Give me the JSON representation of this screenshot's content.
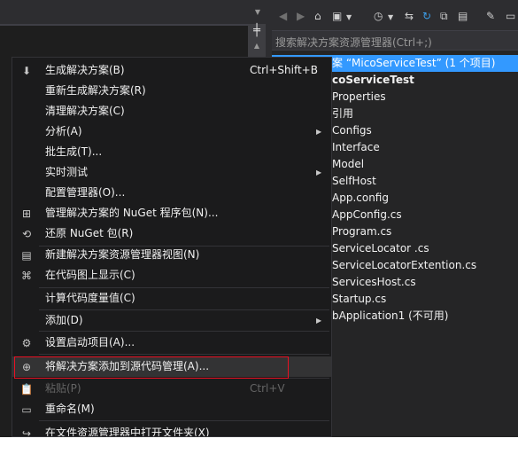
{
  "solution_explorer": {
    "search_placeholder": "搜索解决方案资源管理器(Ctrl+;)",
    "toolbar_icons": [
      "back-icon",
      "forward-icon",
      "home-icon",
      "switch-views-icon",
      "dropdown-arrow-icon",
      "history-icon",
      "dropdown-arrow-icon",
      "sync-icon",
      "refresh-icon",
      "collapse-all-icon",
      "show-all-files-icon",
      "properties-icon",
      "preview-icon"
    ],
    "tree": [
      {
        "label": "案 “MicoServiceTest” (1 个项目)",
        "selected": true
      },
      {
        "label": "coServiceTest",
        "bold": true
      },
      {
        "label": "Properties"
      },
      {
        "label": "引用"
      },
      {
        "label": "Configs"
      },
      {
        "label": "Interface"
      },
      {
        "label": "Model"
      },
      {
        "label": "SelfHost"
      },
      {
        "label": "App.config"
      },
      {
        "label": "AppConfig.cs"
      },
      {
        "label": "Program.cs"
      },
      {
        "label": "ServiceLocator .cs"
      },
      {
        "label": "ServiceLocatorExtention.cs"
      },
      {
        "label": "ServicesHost.cs"
      },
      {
        "label": "Startup.cs"
      },
      {
        "label": "bApplication1 (不可用)"
      }
    ]
  },
  "context_menu": {
    "items": [
      {
        "label": "生成解决方案(B)",
        "shortcut": "Ctrl+Shift+B",
        "icon": "build-icon"
      },
      {
        "label": "重新生成解决方案(R)"
      },
      {
        "label": "清理解决方案(C)"
      },
      {
        "label": "分析(A)",
        "submenu": true
      },
      {
        "label": "批生成(T)..."
      },
      {
        "label": "实时测试",
        "submenu": true
      },
      {
        "label": "配置管理器(O)..."
      },
      {
        "label": "管理解决方案的 NuGet 程序包(N)...",
        "icon": "nuget-package-icon"
      },
      {
        "label": "还原 NuGet 包(R)",
        "icon": "restore-package-icon"
      },
      {
        "label": "新建解决方案资源管理器视图(N)",
        "icon": "new-view-icon"
      },
      {
        "label": "在代码图上显示(C)",
        "icon": "code-map-icon"
      },
      {
        "label": "计算代码度量值(C)"
      },
      {
        "label": "添加(D)",
        "submenu": true
      },
      {
        "label": "设置启动项目(A)...",
        "icon": "gear-icon"
      },
      {
        "label": "将解决方案添加到源代码管理(A)...",
        "icon": "add-to-source-control-icon",
        "highlighted": true
      },
      {
        "label": "粘贴(P)",
        "shortcut": "Ctrl+V",
        "icon": "paste-icon",
        "disabled": true
      },
      {
        "label": "重命名(M)",
        "icon": "rename-icon"
      },
      {
        "label": "在文件资源管理器中打开文件夹(X)",
        "icon": "open-folder-icon"
      }
    ]
  }
}
